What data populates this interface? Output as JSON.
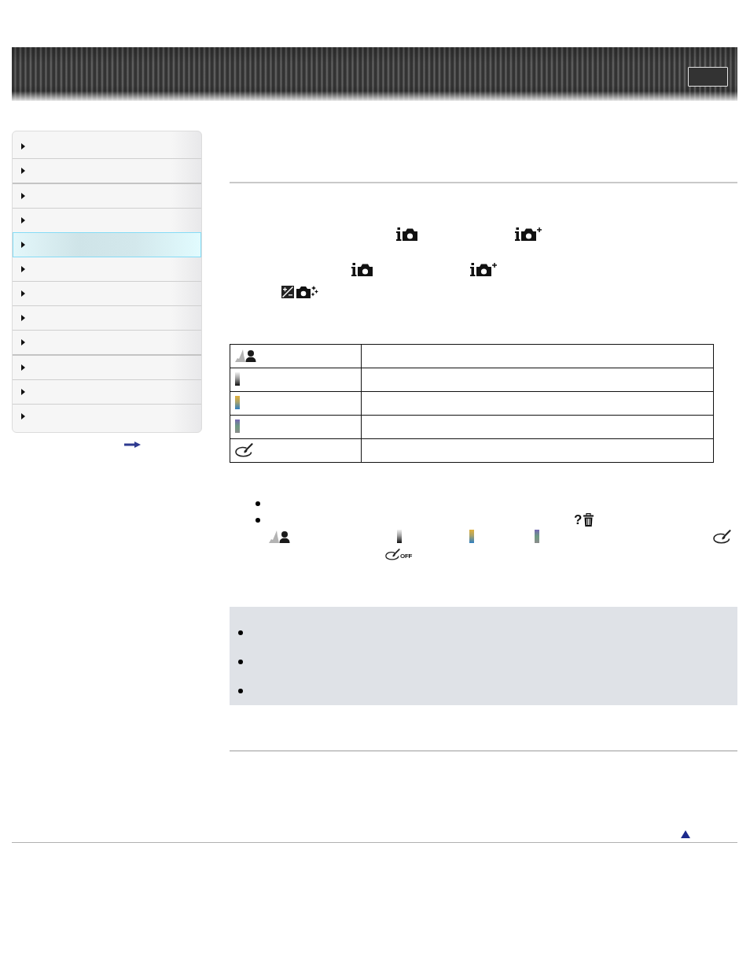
{
  "sidebar": {
    "groups": [
      {
        "items": [
          {
            "selected": false
          },
          {
            "selected": false
          }
        ]
      },
      {
        "items": [
          {
            "selected": false
          },
          {
            "selected": false
          },
          {
            "selected": true
          },
          {
            "selected": false
          },
          {
            "selected": false
          },
          {
            "selected": false
          },
          {
            "selected": false
          }
        ]
      },
      {
        "items": [
          {
            "selected": false
          },
          {
            "selected": false
          },
          {
            "selected": false
          }
        ]
      }
    ]
  },
  "table": {
    "rows": [
      {
        "kind": "scene"
      },
      {
        "kind": "mono"
      },
      {
        "kind": "warm"
      },
      {
        "kind": "cool"
      },
      {
        "kind": "paint"
      }
    ]
  },
  "bullet_list": {
    "help_mark": "?",
    "off_label": "OFF"
  }
}
